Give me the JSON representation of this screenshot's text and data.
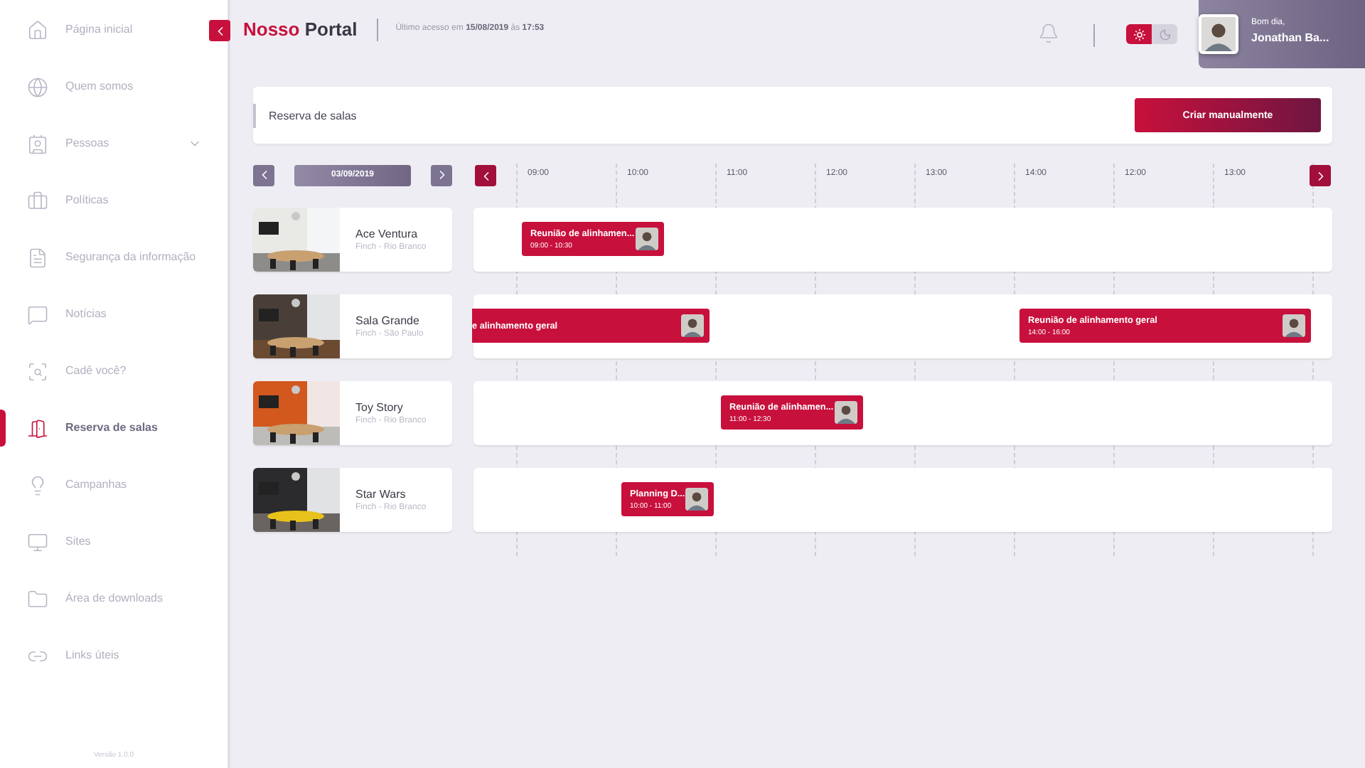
{
  "sidebar": {
    "items": [
      {
        "label": "Página inicial",
        "kind": "home",
        "selected": false
      },
      {
        "label": "Quem somos",
        "kind": "globe",
        "selected": false
      },
      {
        "label": "Pessoas",
        "kind": "people",
        "selected": false,
        "expanded": false
      },
      {
        "label": "Políticas",
        "kind": "briefcase",
        "selected": false
      },
      {
        "label": "Segurança da informação",
        "kind": "document",
        "selected": false
      },
      {
        "label": "Notícias",
        "kind": "chat",
        "selected": false
      },
      {
        "label": "Cadê você?",
        "kind": "find",
        "selected": false
      },
      {
        "label": "Reserva de salas",
        "kind": "door",
        "selected": true
      },
      {
        "label": "Campanhas",
        "kind": "bulb",
        "selected": false
      },
      {
        "label": "Sites",
        "kind": "monitor",
        "selected": false
      },
      {
        "label": "Área de downloads",
        "kind": "folder",
        "selected": false
      },
      {
        "label": "Links úteis",
        "kind": "link",
        "selected": false
      }
    ],
    "version": "Versão 1.0.0"
  },
  "header": {
    "brand_accent": "Nosso",
    "brand": "Portal",
    "last_access": "Último acesso em **15/08/2019** às **17:53**"
  },
  "theme": {
    "options": [
      {
        "kind": "light",
        "selected": true
      },
      {
        "kind": "dark",
        "selected": false
      }
    ]
  },
  "user": {
    "greeting": "Bom dia,",
    "name": "Jonathan Ba..."
  },
  "page_card": {
    "title": "Reserva de salas",
    "button": "Criar manualmente"
  },
  "date": "03/09/2019",
  "timeline": {
    "hours": [
      "09:00",
      "10:00",
      "11:00",
      "12:00",
      "13:00",
      "14:00",
      "12:00",
      "13:00"
    ]
  },
  "rooms": [
    {
      "name": "Ace Ventura",
      "location": "Finch - Rio Branco",
      "events": [
        {
          "kind": "full",
          "title": "Reunião de alinhamen...",
          "time": "09:00 - 10:30"
        }
      ]
    },
    {
      "name": "Sala Grande",
      "location": "Finch - São Paulo",
      "events": [
        {
          "kind": "clipped",
          "title": "e alinhamento geral"
        },
        {
          "kind": "full",
          "title": "Reunião de alinhamento geral",
          "time": "14:00 - 16:00"
        }
      ]
    },
    {
      "name": "Toy Story",
      "location": "Finch - Rio Branco",
      "events": [
        {
          "kind": "full",
          "title": "Reunião de alinhamen...",
          "time": "11:00 - 12:30"
        }
      ]
    },
    {
      "name": "Star Wars",
      "location": "Finch - Rio Branco",
      "events": [
        {
          "kind": "full",
          "title": "Planning D...",
          "time": "10:00 - 11:00"
        }
      ]
    }
  ]
}
